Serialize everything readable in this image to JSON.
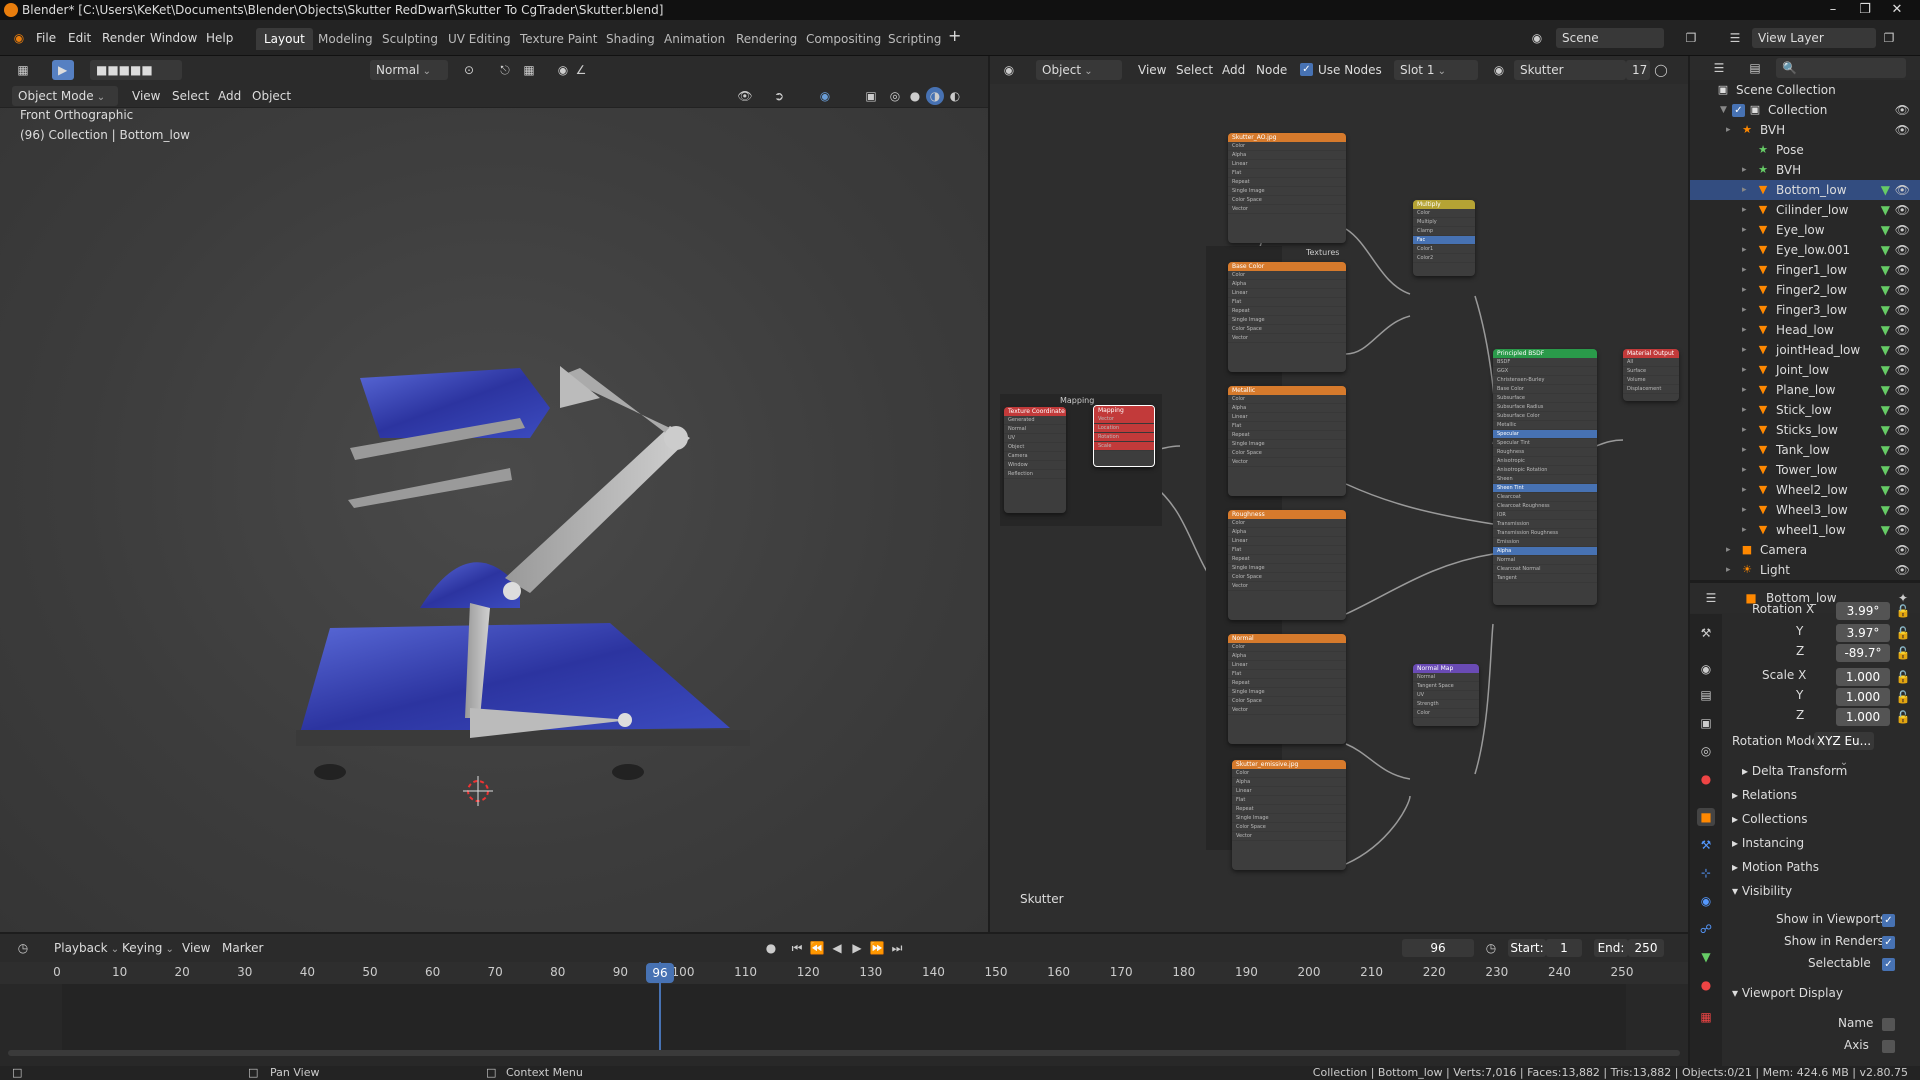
{
  "titlebar": {
    "title": "Blender* [C:\\Users\\KeKet\\Documents\\Blender\\Objects\\Skutter RedDwarf\\Skutter To CgTrader\\Skutter.blend]"
  },
  "menubar": {
    "menus": [
      "File",
      "Edit",
      "Render",
      "Window",
      "Help"
    ],
    "workspaces": [
      "Layout",
      "Modeling",
      "Sculpting",
      "UV Editing",
      "Texture Paint",
      "Shading",
      "Animation",
      "Rendering",
      "Compositing",
      "Scripting"
    ],
    "scene": "Scene",
    "view_layer": "View Layer"
  },
  "viewport": {
    "mode": "Object Mode",
    "menus": [
      "View",
      "Select",
      "Add",
      "Object"
    ],
    "orientation": "Normal",
    "view_name": "Front Orthographic",
    "collection_info": "(96) Collection | Bottom_low"
  },
  "node_editor": {
    "object_type": "Object",
    "menus": [
      "View",
      "Select",
      "Add",
      "Node"
    ],
    "use_nodes_label": "Use Nodes",
    "slot": "Slot 1",
    "material": "Skutter",
    "users": "17",
    "frame_labels": {
      "mapping": "Mapping",
      "textures": "Textures"
    },
    "material_label": "Skutter",
    "nodes": {
      "tex_ao": "Skutter_AO.jpg",
      "base_color": "Base Color",
      "metallic": "Metallic",
      "roughness": "Roughness",
      "normal": "Normal",
      "emissive": "Skutter_emissive.jpg",
      "multiply": "Multiply",
      "normal_map": "Normal Map",
      "principled": "Principled BSDF",
      "output": "Material Output",
      "texcoord": "Texture Coordinate",
      "mapping": "Mapping"
    }
  },
  "outliner": {
    "scene_collection": "Scene Collection",
    "collection": "Collection",
    "items": [
      {
        "label": "BVH",
        "depth": 2
      },
      {
        "label": "Pose",
        "depth": 3
      },
      {
        "label": "BVH",
        "depth": 3
      },
      {
        "label": "Bottom_low",
        "depth": 3
      },
      {
        "label": "Cilinder_low",
        "depth": 3
      },
      {
        "label": "Eye_low",
        "depth": 3
      },
      {
        "label": "Eye_low.001",
        "depth": 3
      },
      {
        "label": "Finger1_low",
        "depth": 3
      },
      {
        "label": "Finger2_low",
        "depth": 3
      },
      {
        "label": "Finger3_low",
        "depth": 3
      },
      {
        "label": "Head_low",
        "depth": 3
      },
      {
        "label": "jointHead_low",
        "depth": 3
      },
      {
        "label": "Joint_low",
        "depth": 3
      },
      {
        "label": "Plane_low",
        "depth": 3
      },
      {
        "label": "Stick_low",
        "depth": 3
      },
      {
        "label": "Sticks_low",
        "depth": 3
      },
      {
        "label": "Tank_low",
        "depth": 3
      },
      {
        "label": "Tower_low",
        "depth": 3
      },
      {
        "label": "Wheel2_low",
        "depth": 3
      },
      {
        "label": "Wheel3_low",
        "depth": 3
      },
      {
        "label": "wheel1_low",
        "depth": 3
      },
      {
        "label": "Camera",
        "depth": 2
      },
      {
        "label": "Light",
        "depth": 2
      }
    ]
  },
  "properties": {
    "object_name": "Bottom_low",
    "rotation_x_label": "Rotation X",
    "rotation_x": "3.99°",
    "rotation_y_label": "Y",
    "rotation_y": "3.97°",
    "rotation_z_label": "Z",
    "rotation_z": "-89.7°",
    "scale_x_label": "Scale X",
    "scale_x": "1.000",
    "scale_y_label": "Y",
    "scale_y": "1.000",
    "scale_z_label": "Z",
    "scale_z": "1.000",
    "rotation_mode_label": "Rotation Mode",
    "rotation_mode": "XYZ Eu...",
    "delta_transform": "Delta Transform",
    "relations": "Relations",
    "collections": "Collections",
    "instancing": "Instancing",
    "motion_paths": "Motion Paths",
    "visibility": "Visibility",
    "show_in_viewports": "Show in Viewports",
    "show_in_renders": "Show in Renders",
    "selectable": "Selectable",
    "viewport_display": "Viewport Display",
    "name_label": "Name",
    "axis_label": "Axis"
  },
  "timeline": {
    "menus": [
      "Playback",
      "Keying",
      "View",
      "Marker"
    ],
    "current_frame": "96",
    "start_label": "Start:",
    "start": "1",
    "end_label": "End:",
    "end": "250",
    "ruler": [
      "0",
      "10",
      "20",
      "30",
      "40",
      "50",
      "60",
      "70",
      "80",
      "90",
      "100",
      "110",
      "120",
      "130",
      "140",
      "150",
      "160",
      "170",
      "180",
      "190",
      "200",
      "210",
      "220",
      "230",
      "240",
      "250"
    ]
  },
  "statusbar": {
    "pan_view": "Pan View",
    "context_menu": "Context Menu",
    "stats": "Collection | Bottom_low | Verts:7,016 | Faces:13,882 | Tris:13,882 | Objects:0/21 | Mem: 424.6 MB | v2.80.75"
  },
  "colors": {
    "accent": "#4772b3",
    "active_frame": "#4772b3",
    "texture_node": "#d67a2c",
    "shader_node": "#2a9a4a",
    "output_node": "#c23a3a"
  }
}
